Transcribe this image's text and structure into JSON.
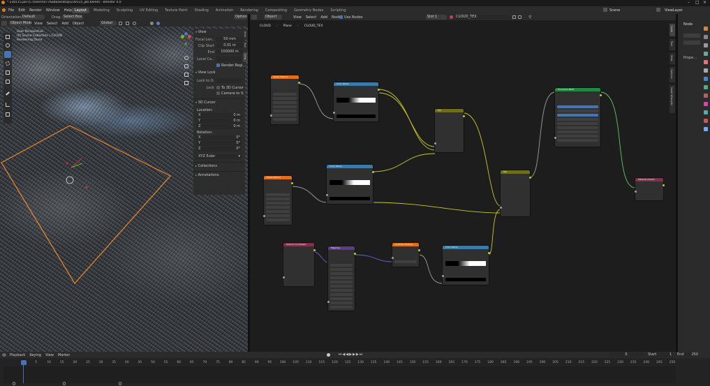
{
  "title": "* 230115.pkl [C:\\Users\\0776ab\\Desktop\\230115_pkl.blend] - Blender 4.0",
  "colors": {
    "accent": "#4772b3",
    "node_input": "#83314a",
    "node_texture": "#e06f19",
    "node_shader": "#1e8a3c",
    "node_converter": "#3e7aa5",
    "node_color": "#6e6e1d",
    "node_vector": "#5a3d8c",
    "selection": "#ee8a2a",
    "wire_yellow": "#c7c729",
    "wire_gray": "#a0a0a0",
    "wire_purple": "#6463c7",
    "wire_green": "#63c763"
  },
  "menu": [
    "File",
    "Edit",
    "Render",
    "Window",
    "Help"
  ],
  "workspaces": [
    "Layout",
    "Modeling",
    "Sculpting",
    "UV Editing",
    "Texture Paint",
    "Shading",
    "Animation",
    "Rendering",
    "Compositing",
    "Geometry Nodes",
    "Scripting"
  ],
  "scene": "Scene",
  "view_layer": "ViewLayer",
  "viewport": {
    "orientation_label": "Orientation:",
    "orientation": "Default",
    "drag_label": "Drag:",
    "drag": "Select Box",
    "mode": "Object Mode",
    "menu": [
      "View",
      "Select",
      "Add",
      "Object"
    ],
    "transform": "Global",
    "options": "Options",
    "overlay_lines": [
      "User Perspective",
      "(0) Scene Collection | CLOUD",
      "Rendering Done"
    ]
  },
  "npanel": {
    "tabs": [
      "Item",
      "Tool",
      "View"
    ],
    "view_header": "View",
    "rows": [
      {
        "label": "Focal Len...",
        "value": "50 mm"
      },
      {
        "label": "Clip Start",
        "value": "0.01 m"
      },
      {
        "label": "End",
        "value": "100000 m"
      }
    ],
    "local_camera": "Local Ca...",
    "render_region": "Render Regi...",
    "view_lock_header": "View Lock",
    "lock_to_object": "Lock to O...",
    "lock": "Lock",
    "to_3d_cursor": "To 3D Cursor",
    "camera_to_view": "Camera to V...",
    "cursor_header": "3D Cursor",
    "location": "Location:",
    "rotation": "Rotation:",
    "loc": [
      {
        "a": "X",
        "v": "0 m"
      },
      {
        "a": "Y",
        "v": "0 m"
      },
      {
        "a": "Z",
        "v": "0 m"
      }
    ],
    "rot": [
      {
        "a": "X",
        "v": "0°"
      },
      {
        "a": "Y",
        "v": "0°"
      },
      {
        "a": "Z",
        "v": "0°"
      }
    ],
    "euler": "XYZ Euler",
    "collections": "Collections",
    "annotations": "Annotations"
  },
  "node_editor": {
    "object_label": "Object",
    "menu": [
      "View",
      "Select",
      "Add",
      "Node"
    ],
    "use_nodes": "Use Nodes",
    "slot": "Slot 1",
    "material": "CLOUD_TEX",
    "breadcrumb": [
      "CLOUD",
      "Plane",
      "CLOUD_TEX"
    ],
    "side_tabs": [
      "Node",
      "Tool",
      "View",
      "Options",
      "Node Wrangler"
    ],
    "right_panel": "Node",
    "right_panel_props": "Prope..."
  },
  "nodes": [
    {
      "id": "noise1",
      "title": "Noise Texture",
      "kind": "texture"
    },
    {
      "id": "ramp1",
      "title": "Color Ramp",
      "kind": "converter"
    },
    {
      "id": "mix1",
      "title": "Mix",
      "kind": "color"
    },
    {
      "id": "bsdf",
      "title": "Principled BSDF",
      "kind": "shader"
    },
    {
      "id": "noise2",
      "title": "Noise Texture",
      "kind": "texture"
    },
    {
      "id": "ramp2",
      "title": "Color Ramp",
      "kind": "converter"
    },
    {
      "id": "mix2",
      "title": "Mix",
      "kind": "color"
    },
    {
      "id": "output",
      "title": "Material Output",
      "kind": "input"
    },
    {
      "id": "texcoord",
      "title": "Texture Coordinate",
      "kind": "input"
    },
    {
      "id": "mapping",
      "title": "Mapping",
      "kind": "vector"
    },
    {
      "id": "gradient",
      "title": "Gradient Texture",
      "kind": "texture"
    },
    {
      "id": "ramp3",
      "title": "Color Ramp",
      "kind": "converter"
    }
  ],
  "timeline": {
    "menu": [
      "Playback",
      "Keying",
      "View",
      "Marker"
    ],
    "current_frame": "0",
    "start_label": "Start",
    "start": "1",
    "end_label": "End",
    "end": "250",
    "ticks": [
      "0",
      "5",
      "10",
      "15",
      "20",
      "25",
      "30",
      "35",
      "40",
      "45",
      "50",
      "55",
      "60",
      "65",
      "70",
      "75",
      "80",
      "85",
      "90",
      "95",
      "100",
      "105",
      "110",
      "115",
      "120",
      "125",
      "130",
      "135",
      "140",
      "145",
      "150",
      "155",
      "160",
      "165",
      "170",
      "175",
      "180",
      "185",
      "190",
      "195",
      "200",
      "205",
      "210",
      "215",
      "220",
      "225",
      "230",
      "235",
      "240",
      "245",
      "250"
    ]
  }
}
